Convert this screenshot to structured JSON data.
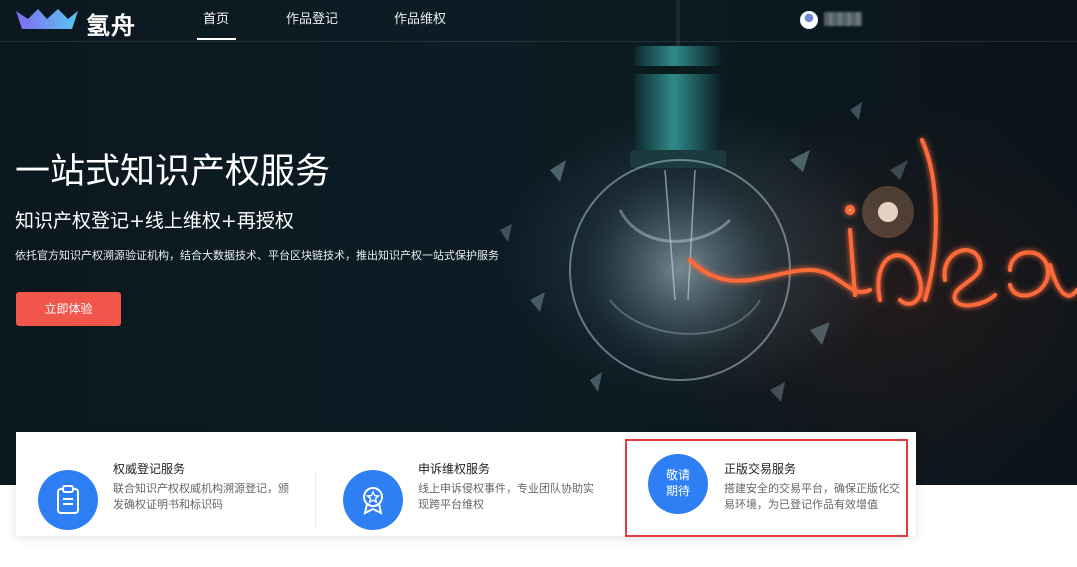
{
  "header": {
    "logo_text": "氢舟",
    "nav": [
      {
        "label": "首页",
        "active": true
      },
      {
        "label": "作品登记",
        "active": false
      },
      {
        "label": "作品维权",
        "active": false
      }
    ],
    "user_name": "xxxx"
  },
  "hero": {
    "title": "一站式知识产权服务",
    "subtitle": "知识产权登记+线上维权+再授权",
    "description": "依托官方知识产权溯源验证机构，结合大数据技术、平台区块链技术，推出知识产权一站式保护服务",
    "cta_label": "立即体验"
  },
  "services": [
    {
      "icon": "certificate-clipboard-icon",
      "title": "权威登记服务",
      "description": "联合知识产权权威机构溯源登记，颁发确权证明书和标识码"
    },
    {
      "icon": "award-badge-icon",
      "title": "申诉维权服务",
      "description": "线上申诉侵权事件，专业团队协助实现跨平台维权"
    },
    {
      "icon_text_line1": "敬请",
      "icon_text_line2": "期待",
      "title": "正版交易服务",
      "description": "搭建安全的交易平台，确保正版化交易环境，为已登记作品有效增值"
    }
  ],
  "colors": {
    "accent": "#2f7ff4",
    "cta": "#f0564a",
    "highlight": "#e03c3c",
    "hero_bg": "#0d1c24"
  }
}
